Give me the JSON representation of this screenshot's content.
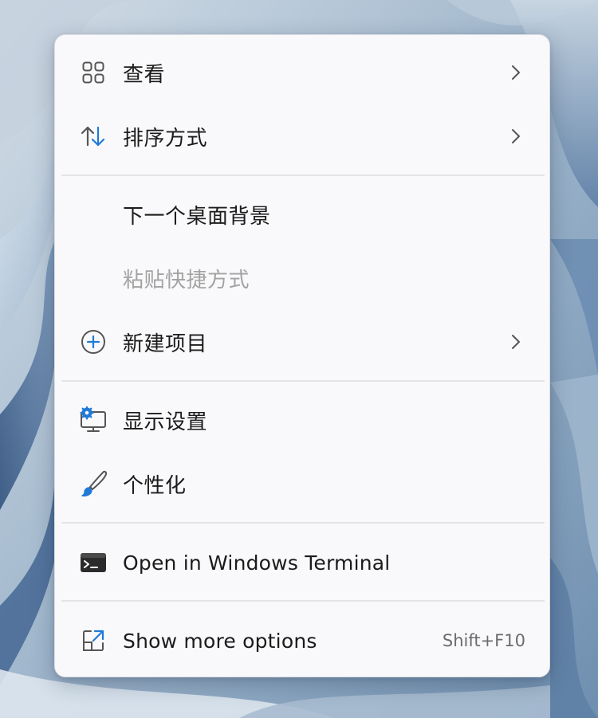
{
  "menu": {
    "items": [
      {
        "label": "查看",
        "icon": "grid-view-icon",
        "has_submenu": true,
        "disabled": false
      },
      {
        "label": "排序方式",
        "icon": "sort-arrows-icon",
        "has_submenu": true,
        "disabled": false
      },
      {
        "label": "下一个桌面背景",
        "icon": "",
        "has_submenu": false,
        "disabled": false
      },
      {
        "label": "粘贴快捷方式",
        "icon": "",
        "has_submenu": false,
        "disabled": true
      },
      {
        "label": "新建项目",
        "icon": "add-circle-icon",
        "has_submenu": true,
        "disabled": false
      },
      {
        "label": "显示设置",
        "icon": "display-settings-icon",
        "has_submenu": false,
        "disabled": false
      },
      {
        "label": "个性化",
        "icon": "paintbrush-icon",
        "has_submenu": false,
        "disabled": false
      },
      {
        "label": "Open in Windows Terminal",
        "icon": "terminal-icon",
        "has_submenu": false,
        "disabled": false
      },
      {
        "label": "Show more options",
        "icon": "open-external-icon",
        "has_submenu": false,
        "disabled": false,
        "shortcut": "Shift+F10"
      }
    ]
  },
  "colors": {
    "menu_background": "#f9f9fb",
    "text": "#1b1b1b",
    "disabled_text": "#a3a3a3",
    "accent_blue": "#1f7ad6",
    "separator": "#e4e4e6"
  }
}
